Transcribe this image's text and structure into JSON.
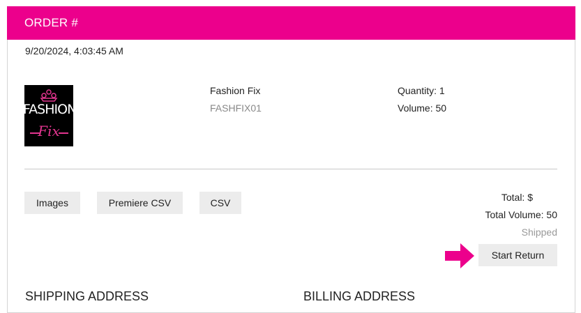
{
  "header": {
    "title": "ORDER #"
  },
  "order": {
    "date": "9/20/2024, 4:03:45 AM"
  },
  "product": {
    "logo_text": "FASHION",
    "logo_subtext": "Fix",
    "name": "Fashion Fix",
    "sku": "FASHFIX01",
    "quantity": "Quantity: 1",
    "volume": "Volume: 50"
  },
  "actions": {
    "images": "Images",
    "premiere_csv": "Premiere CSV",
    "csv": "CSV",
    "start_return": "Start Return"
  },
  "summary": {
    "total": "Total: $",
    "total_volume": "Total Volume: 50",
    "status": "Shipped"
  },
  "sections": {
    "shipping": "SHIPPING ADDRESS",
    "billing": "BILLING ADDRESS"
  },
  "colors": {
    "accent": "#ec008c",
    "button_bg": "#ececec"
  },
  "icons": {
    "annotation": "arrow-right-icon"
  }
}
